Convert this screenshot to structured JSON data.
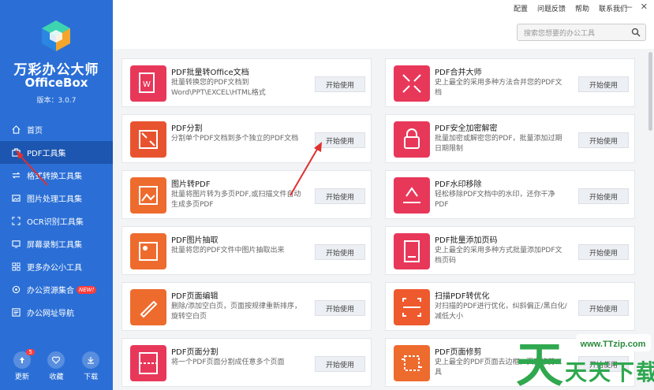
{
  "app": {
    "name": "万彩办公大师",
    "name_en": "OfficeBox",
    "version": "版本：3.0.7"
  },
  "toplinks": [
    "配置",
    "问题反馈",
    "帮助",
    "联系我们"
  ],
  "search": {
    "placeholder": "搜索您想要的办公工具"
  },
  "nav": [
    {
      "label": "首页",
      "icon": "home-icon"
    },
    {
      "label": "PDF工具集",
      "icon": "pdf-tools-icon",
      "active": true
    },
    {
      "label": "格式转换工具集",
      "icon": "convert-icon"
    },
    {
      "label": "图片处理工具集",
      "icon": "image-icon"
    },
    {
      "label": "OCR识别工具集",
      "icon": "ocr-icon"
    },
    {
      "label": "屏幕录制工具集",
      "icon": "screen-record-icon"
    },
    {
      "label": "更多办公小工具",
      "icon": "grid-icon"
    },
    {
      "label": "办公资源集合",
      "icon": "resource-icon",
      "badge": "NEW!"
    },
    {
      "label": "办公网址导航",
      "icon": "nav-link-icon"
    }
  ],
  "bottom": [
    {
      "label": "更新",
      "icon": "update-icon",
      "count": "5"
    },
    {
      "label": "收藏",
      "icon": "heart-icon"
    },
    {
      "label": "下载",
      "icon": "download-icon"
    }
  ],
  "button_label": "开始使用",
  "cards": [
    {
      "title": "PDF批量转Office文档",
      "desc": "批量转换您的PDF文档到Word\\PPT\\EXCEL\\HTML格式",
      "color": "#e8385a"
    },
    {
      "title": "PDF合并大师",
      "desc": "史上最全的采用多种方法合并您的PDF文档",
      "color": "#e8385a"
    },
    {
      "title": "PDF分割",
      "desc": "分割单个PDF文档到多个独立的PDF文档",
      "color": "#e8532f"
    },
    {
      "title": "PDF安全加密解密",
      "desc": "批量加密或解密您的PDF，批量添加过期日期限制",
      "color": "#e8385a"
    },
    {
      "title": "图片转PDF",
      "desc": "批量将图片转为多页PDF,或扫描文件自动生成多页PDF",
      "color": "#ee6b2e"
    },
    {
      "title": "PDF水印移除",
      "desc": "轻松移除PDF文档中的水印，还你干净PDF",
      "color": "#e8385a"
    },
    {
      "title": "PDF图片抽取",
      "desc": "批量将您的PDF文件中图片抽取出来",
      "color": "#ee6b2e"
    },
    {
      "title": "PDF批量添加页码",
      "desc": "史上最全的采用多种方式批量添加PDF文档页码",
      "color": "#e8385a"
    },
    {
      "title": "PDF页面编辑",
      "desc": "删除/添加空白页，页面按规律重新排序，旋转空白页",
      "color": "#ee6b2e"
    },
    {
      "title": "扫描PDF转优化",
      "desc": "对扫描的PDF进行优化，纠斜偏正/黑白化/减低大小",
      "color": "#ee5a2e"
    },
    {
      "title": "PDF页面分割",
      "desc": "将一个PDF页面分割成任意多个页面",
      "color": "#e8385a"
    },
    {
      "title": "PDF页面修剪",
      "desc": "史上最全的PDF页面去边框，页面修剪工具",
      "color": "#ee6b2e"
    }
  ],
  "watermark": {
    "url": "www.TTzip.com",
    "text": "天天下载",
    "logo_char": "天"
  },
  "colors": {
    "sidebar": "#2b6fd6",
    "active": "#1d56b0",
    "accent_red": "#e8385a",
    "accent_orange": "#ee6b2e",
    "arrow": "#e03030"
  }
}
